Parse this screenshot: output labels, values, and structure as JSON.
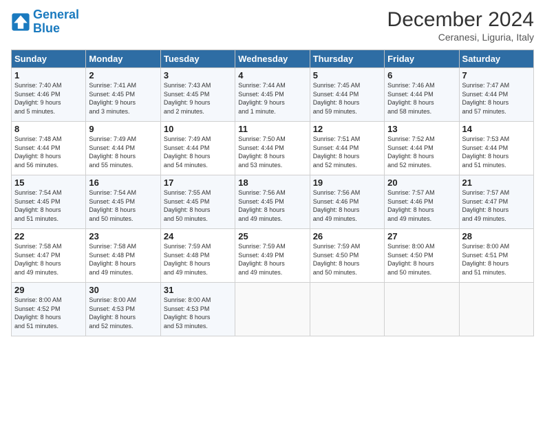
{
  "header": {
    "logo_line1": "General",
    "logo_line2": "Blue",
    "month": "December 2024",
    "location": "Ceranesi, Liguria, Italy"
  },
  "days_of_week": [
    "Sunday",
    "Monday",
    "Tuesday",
    "Wednesday",
    "Thursday",
    "Friday",
    "Saturday"
  ],
  "weeks": [
    [
      {
        "day": "1",
        "info": "Sunrise: 7:40 AM\nSunset: 4:46 PM\nDaylight: 9 hours\nand 5 minutes."
      },
      {
        "day": "2",
        "info": "Sunrise: 7:41 AM\nSunset: 4:45 PM\nDaylight: 9 hours\nand 3 minutes."
      },
      {
        "day": "3",
        "info": "Sunrise: 7:43 AM\nSunset: 4:45 PM\nDaylight: 9 hours\nand 2 minutes."
      },
      {
        "day": "4",
        "info": "Sunrise: 7:44 AM\nSunset: 4:45 PM\nDaylight: 9 hours\nand 1 minute."
      },
      {
        "day": "5",
        "info": "Sunrise: 7:45 AM\nSunset: 4:44 PM\nDaylight: 8 hours\nand 59 minutes."
      },
      {
        "day": "6",
        "info": "Sunrise: 7:46 AM\nSunset: 4:44 PM\nDaylight: 8 hours\nand 58 minutes."
      },
      {
        "day": "7",
        "info": "Sunrise: 7:47 AM\nSunset: 4:44 PM\nDaylight: 8 hours\nand 57 minutes."
      }
    ],
    [
      {
        "day": "8",
        "info": "Sunrise: 7:48 AM\nSunset: 4:44 PM\nDaylight: 8 hours\nand 56 minutes."
      },
      {
        "day": "9",
        "info": "Sunrise: 7:49 AM\nSunset: 4:44 PM\nDaylight: 8 hours\nand 55 minutes."
      },
      {
        "day": "10",
        "info": "Sunrise: 7:49 AM\nSunset: 4:44 PM\nDaylight: 8 hours\nand 54 minutes."
      },
      {
        "day": "11",
        "info": "Sunrise: 7:50 AM\nSunset: 4:44 PM\nDaylight: 8 hours\nand 53 minutes."
      },
      {
        "day": "12",
        "info": "Sunrise: 7:51 AM\nSunset: 4:44 PM\nDaylight: 8 hours\nand 52 minutes."
      },
      {
        "day": "13",
        "info": "Sunrise: 7:52 AM\nSunset: 4:44 PM\nDaylight: 8 hours\nand 52 minutes."
      },
      {
        "day": "14",
        "info": "Sunrise: 7:53 AM\nSunset: 4:44 PM\nDaylight: 8 hours\nand 51 minutes."
      }
    ],
    [
      {
        "day": "15",
        "info": "Sunrise: 7:54 AM\nSunset: 4:45 PM\nDaylight: 8 hours\nand 51 minutes."
      },
      {
        "day": "16",
        "info": "Sunrise: 7:54 AM\nSunset: 4:45 PM\nDaylight: 8 hours\nand 50 minutes."
      },
      {
        "day": "17",
        "info": "Sunrise: 7:55 AM\nSunset: 4:45 PM\nDaylight: 8 hours\nand 50 minutes."
      },
      {
        "day": "18",
        "info": "Sunrise: 7:56 AM\nSunset: 4:45 PM\nDaylight: 8 hours\nand 49 minutes."
      },
      {
        "day": "19",
        "info": "Sunrise: 7:56 AM\nSunset: 4:46 PM\nDaylight: 8 hours\nand 49 minutes."
      },
      {
        "day": "20",
        "info": "Sunrise: 7:57 AM\nSunset: 4:46 PM\nDaylight: 8 hours\nand 49 minutes."
      },
      {
        "day": "21",
        "info": "Sunrise: 7:57 AM\nSunset: 4:47 PM\nDaylight: 8 hours\nand 49 minutes."
      }
    ],
    [
      {
        "day": "22",
        "info": "Sunrise: 7:58 AM\nSunset: 4:47 PM\nDaylight: 8 hours\nand 49 minutes."
      },
      {
        "day": "23",
        "info": "Sunrise: 7:58 AM\nSunset: 4:48 PM\nDaylight: 8 hours\nand 49 minutes."
      },
      {
        "day": "24",
        "info": "Sunrise: 7:59 AM\nSunset: 4:48 PM\nDaylight: 8 hours\nand 49 minutes."
      },
      {
        "day": "25",
        "info": "Sunrise: 7:59 AM\nSunset: 4:49 PM\nDaylight: 8 hours\nand 49 minutes."
      },
      {
        "day": "26",
        "info": "Sunrise: 7:59 AM\nSunset: 4:50 PM\nDaylight: 8 hours\nand 50 minutes."
      },
      {
        "day": "27",
        "info": "Sunrise: 8:00 AM\nSunset: 4:50 PM\nDaylight: 8 hours\nand 50 minutes."
      },
      {
        "day": "28",
        "info": "Sunrise: 8:00 AM\nSunset: 4:51 PM\nDaylight: 8 hours\nand 51 minutes."
      }
    ],
    [
      {
        "day": "29",
        "info": "Sunrise: 8:00 AM\nSunset: 4:52 PM\nDaylight: 8 hours\nand 51 minutes."
      },
      {
        "day": "30",
        "info": "Sunrise: 8:00 AM\nSunset: 4:53 PM\nDaylight: 8 hours\nand 52 minutes."
      },
      {
        "day": "31",
        "info": "Sunrise: 8:00 AM\nSunset: 4:53 PM\nDaylight: 8 hours\nand 53 minutes."
      },
      {
        "day": "",
        "info": ""
      },
      {
        "day": "",
        "info": ""
      },
      {
        "day": "",
        "info": ""
      },
      {
        "day": "",
        "info": ""
      }
    ]
  ]
}
